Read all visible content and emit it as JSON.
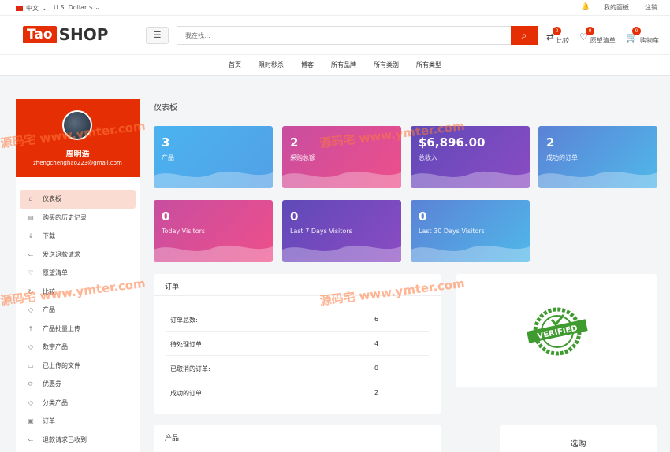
{
  "topbar": {
    "language": "中文",
    "currency": "U.S. Dollar $",
    "links": [
      "我的面板",
      "注销"
    ]
  },
  "header": {
    "logo_left": "Tao",
    "logo_right": "SHOP",
    "search_placeholder": "我在找...",
    "compare_label": "比较",
    "compare_count": "0",
    "wishlist_label": "愿望清单",
    "wishlist_count": "0",
    "cart_label": "购物车",
    "cart_count": "0"
  },
  "nav": [
    "首页",
    "限时秒杀",
    "博客",
    "所有品牌",
    "所有类别",
    "所有类型"
  ],
  "profile": {
    "name": "周明浩",
    "email": "zhengchenghao223@gmail.com"
  },
  "sidebar": [
    {
      "label": "仪表板",
      "icon": "home-icon",
      "active": true
    },
    {
      "label": "购买的历史记录",
      "icon": "file-icon"
    },
    {
      "label": "下载",
      "icon": "download-icon"
    },
    {
      "label": "发送退款请求",
      "icon": "refund-icon"
    },
    {
      "label": "愿望清单",
      "icon": "heart-icon"
    },
    {
      "label": "比较",
      "icon": "compare-icon"
    },
    {
      "label": "产品",
      "icon": "diamond-icon"
    },
    {
      "label": "产品批量上传",
      "icon": "upload-icon"
    },
    {
      "label": "数字产品",
      "icon": "diamond-icon"
    },
    {
      "label": "已上传的文件",
      "icon": "folder-icon"
    },
    {
      "label": "优惠券",
      "icon": "coupon-icon"
    },
    {
      "label": "分类产品",
      "icon": "diamond-icon"
    },
    {
      "label": "订单",
      "icon": "order-icon"
    },
    {
      "label": "退款请求已收到",
      "icon": "refund-icon"
    }
  ],
  "dashboard": {
    "title": "仪表板",
    "cards": [
      {
        "value": "3",
        "label": "产品"
      },
      {
        "value": "2",
        "label": "采购总额"
      },
      {
        "value": "$6,896.00",
        "label": "总收入"
      },
      {
        "value": "2",
        "label": "成功的订单"
      },
      {
        "value": "0",
        "label": "Today Visitors"
      },
      {
        "value": "0",
        "label": "Last 7 Days Visitors"
      },
      {
        "value": "0",
        "label": "Last 30 Days Visitors"
      }
    ]
  },
  "orders": {
    "title": "订单",
    "rows": [
      {
        "label": "订单总数:",
        "value": "6"
      },
      {
        "label": "待处理订单:",
        "value": "4"
      },
      {
        "label": "已取消的订单:",
        "value": "0"
      },
      {
        "label": "成功的订单:",
        "value": "2"
      }
    ]
  },
  "verified": {
    "text": "VERIFIED"
  },
  "products_panel": {
    "title": "产品"
  },
  "buy_panel": {
    "title": "选购"
  },
  "watermark": {
    "text": "源码宅  www.ymter.com"
  },
  "colors": {
    "accent": "#e62e04"
  }
}
